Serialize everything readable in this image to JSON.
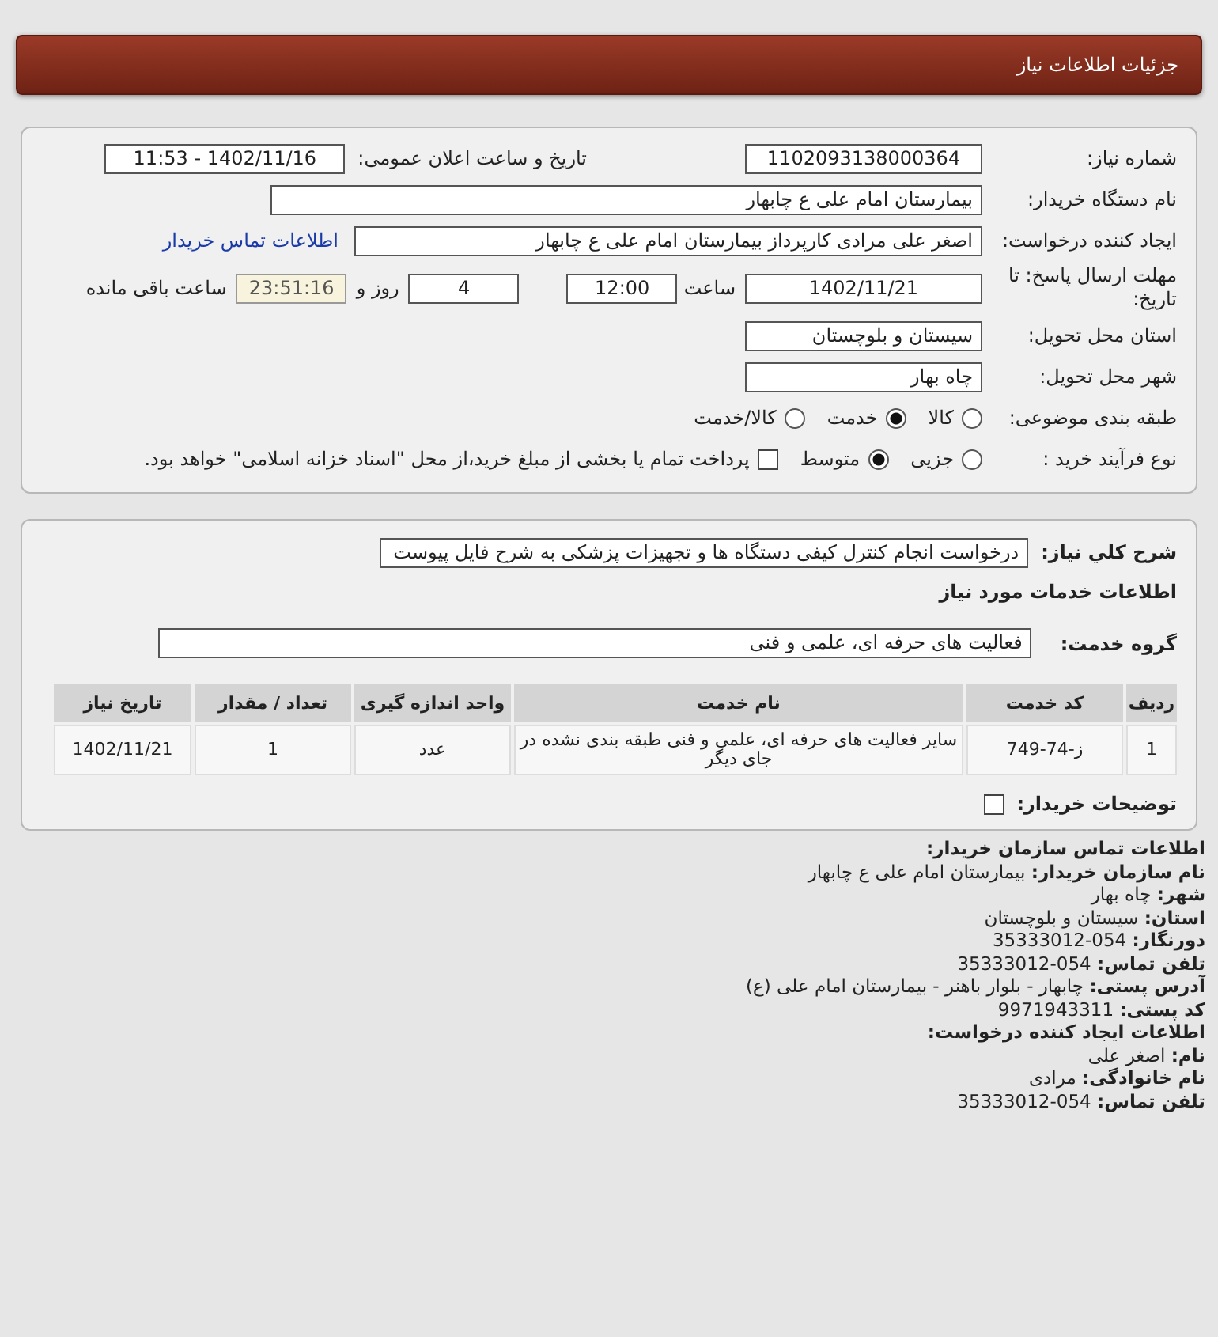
{
  "page_title": "جزئیات اطلاعات نیاز",
  "form_rows": [
    [
      {
        "kind": "label",
        "text": "شماره نیاز:"
      },
      {
        "kind": "field",
        "value": "1102093138000364"
      },
      {
        "kind": "label",
        "text": "تاریخ و ساعت اعلان عمومی:"
      },
      {
        "kind": "field",
        "value": "1402/11/16 - 11:53"
      }
    ],
    [
      {
        "kind": "label",
        "text": "نام دستگاه خریدار:"
      },
      {
        "kind": "field",
        "value": "بیمارستان امام علی  ع  چابهار"
      }
    ],
    [
      {
        "kind": "label",
        "text": "ایجاد کننده درخواست:"
      },
      {
        "kind": "field",
        "value": "اصغر علی مرادی کارپرداز بیمارستان امام علی  ع  چابهار"
      },
      {
        "kind": "link",
        "text": "اطلاعات تماس خریدار"
      }
    ],
    [
      {
        "kind": "label",
        "text": "مهلت ارسال پاسخ: تا تاریخ:"
      },
      {
        "kind": "field",
        "value": "1402/11/21"
      },
      {
        "kind": "text",
        "text": "ساعت"
      },
      {
        "kind": "field",
        "value": "12:00"
      },
      {
        "kind": "field",
        "value": "4"
      },
      {
        "kind": "text",
        "text": "روز و"
      },
      {
        "kind": "timer",
        "value": "23:51:16"
      },
      {
        "kind": "text",
        "text": "ساعت باقی مانده"
      }
    ],
    [
      {
        "kind": "label",
        "text": "استان محل تحویل:"
      },
      {
        "kind": "field",
        "value": "سیستان و بلوچستان"
      }
    ],
    [
      {
        "kind": "label",
        "text": "شهر محل تحویل:"
      },
      {
        "kind": "field",
        "value": "چاه بهار"
      }
    ],
    [
      {
        "kind": "label",
        "text": "طبقه بندی موضوعی:"
      },
      {
        "kind": "radio",
        "text": "کالا",
        "selected": false
      },
      {
        "kind": "radio",
        "text": "خدمت",
        "selected": true
      },
      {
        "kind": "radio",
        "text": "کالا/خدمت",
        "selected": false
      }
    ],
    [
      {
        "kind": "label",
        "text": "نوع فرآیند خرید :"
      },
      {
        "kind": "radio",
        "text": "جزیی",
        "selected": false
      },
      {
        "kind": "radio",
        "text": "متوسط",
        "selected": true
      },
      {
        "kind": "checkbox",
        "text": "پرداخت تمام یا بخشی از مبلغ خرید،از محل \"اسناد خزانه اسلامی\" خواهد بود.",
        "checked": false
      }
    ]
  ],
  "description": {
    "label": "شرح کلي نياز:",
    "value": "درخواست انجام کنترل کیفی دستگاه ها و تجهیزات پزشکی به شرح فایل پیوست"
  },
  "services_heading": "اطلاعات خدمات مورد نیاز",
  "service_group": {
    "label": "گروه خدمت:",
    "value": "فعالیت های حرفه ای، علمی و فنی"
  },
  "table": {
    "columns": [
      "ردیف",
      "کد خدمت",
      "نام خدمت",
      "واحد اندازه گیری",
      "تعداد / مقدار",
      "تاریخ نیاز"
    ],
    "rows": [
      [
        "1",
        "ز-74-749",
        "سایر فعالیت های حرفه ای، علمی و فنی طبقه بندی نشده در جای دیگر",
        "عدد",
        "1",
        "1402/11/21"
      ]
    ]
  },
  "buyer_notes": {
    "label": "توضیحات خریدار:",
    "checked": false
  },
  "contact_lines": [
    "**اطلاعات تماس سازمان خریدار:**",
    "**نام سازمان خریدار:** بیمارستان امام علی ع چابهار",
    "**شهر:** چاه بهار",
    "**استان:** سیستان و بلوچستان",
    "**دورنگار:** 054-35333012",
    "**تلفن تماس:** 054-35333012",
    "**آدرس پستی:** چابهار - بلوار باهنر - بیمارستان امام علی (ع)",
    "**کد پستی:** 9971943311",
    "**اطلاعات ایجاد کننده درخواست:**",
    "**نام:** اصغر علی",
    "**نام خانوادگی:** مرادی",
    "**تلفن تماس:** 054-35333012"
  ]
}
